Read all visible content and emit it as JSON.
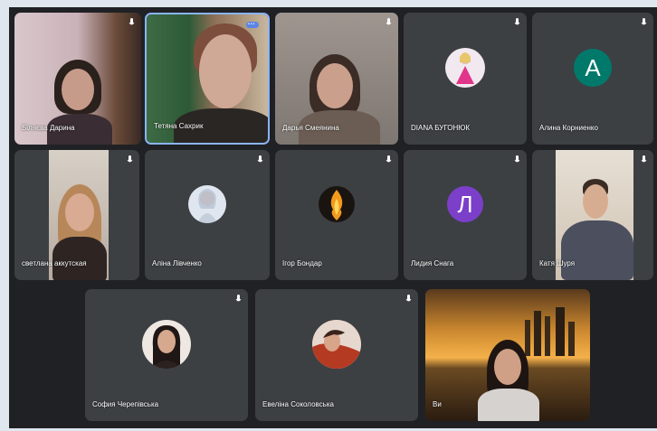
{
  "participants": [
    {
      "name": "Біляєва Дарина",
      "type": "video"
    },
    {
      "name": "Тетяна Сахрик",
      "type": "video",
      "speaking": true
    },
    {
      "name": "Дарья Смеянина",
      "type": "video"
    },
    {
      "name": "DIANA БУГОНЮК",
      "type": "avatar-image"
    },
    {
      "name": "Алина Корниенко",
      "type": "avatar-letter",
      "letter": "А",
      "color": "#00796b"
    },
    {
      "name": "светлана аккутская",
      "type": "video"
    },
    {
      "name": "Аліна Лівченко",
      "type": "avatar-image"
    },
    {
      "name": "Ігор Бондар",
      "type": "avatar-image"
    },
    {
      "name": "Лидия Снага",
      "type": "avatar-letter",
      "letter": "Л",
      "color": "#7b3fc9"
    },
    {
      "name": "Катя Шуря",
      "type": "video"
    },
    {
      "name": "София Черепівська",
      "type": "avatar-image"
    },
    {
      "name": "Евеліна Соколовська",
      "type": "avatar-image"
    },
    {
      "name": "Ви",
      "type": "video"
    }
  ],
  "icons": {
    "mic": "microphone-icon",
    "more": "more-options-icon"
  },
  "colors": {
    "stage": "#202124",
    "tile": "#3c4043",
    "speaking_border": "#8ab4f8"
  }
}
